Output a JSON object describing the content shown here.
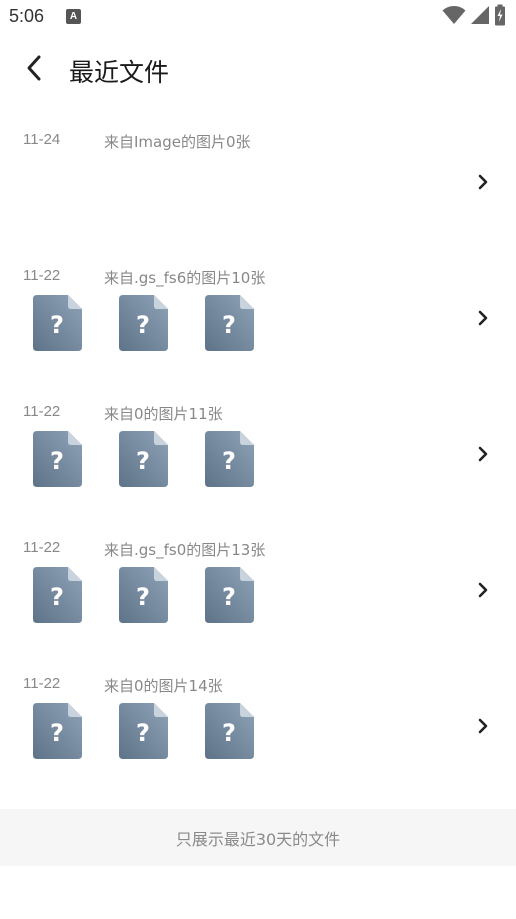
{
  "status_bar": {
    "time": "5:06",
    "notification_badge": "A",
    "icons": [
      "wifi-icon",
      "signal-icon",
      "battery-icon"
    ]
  },
  "header": {
    "title": "最近文件",
    "back_icon": "back-arrow-icon"
  },
  "groups": [
    {
      "date": "11-24",
      "description": "来自Image的图片0张",
      "thumbnail_count": 0
    },
    {
      "date": "11-22",
      "description": "来自.gs_fs6的图片10张",
      "thumbnail_count": 3
    },
    {
      "date": "11-22",
      "description": "来自0的图片11张",
      "thumbnail_count": 3
    },
    {
      "date": "11-22",
      "description": "来自.gs_fs0的图片13张",
      "thumbnail_count": 3
    },
    {
      "date": "11-22",
      "description": "来自0的图片14张",
      "thumbnail_count": 3
    }
  ],
  "thumbnail_icon": "unknown-file-icon",
  "footer": {
    "note": "只展示最近30天的文件"
  },
  "colors": {
    "thumbnail_dark": "#5f7388",
    "thumbnail_light": "#8fa3b8",
    "text_secondary": "#888888",
    "footer_bg": "#f6f6f6"
  }
}
